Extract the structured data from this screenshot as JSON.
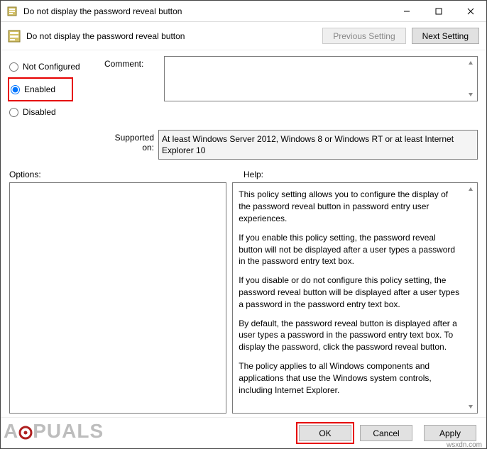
{
  "window": {
    "title": "Do not display the password reveal button",
    "sysmenu": {
      "min": "minimize",
      "max": "maximize",
      "close": "close"
    }
  },
  "toolbar": {
    "title": "Do not display the password reveal button",
    "prev_btn": "Previous Setting",
    "next_btn": "Next Setting"
  },
  "radios": {
    "not_configured": "Not Configured",
    "enabled": "Enabled",
    "disabled": "Disabled",
    "selected": "enabled"
  },
  "labels": {
    "comment": "Comment:",
    "supported": "Supported on:",
    "options": "Options:",
    "help": "Help:"
  },
  "supported_on": "At least Windows Server 2012, Windows 8 or Windows RT or at least Internet Explorer 10",
  "help": {
    "p1": "This policy setting allows you to configure the display of the password reveal button in password entry user experiences.",
    "p2": "If you enable this policy setting, the password reveal button will not be displayed after a user types a password in the password entry text box.",
    "p3": "If you disable or do not configure this policy setting, the password reveal button will be displayed after a user types a password in the password entry text box.",
    "p4": "By default, the password reveal button is displayed after a user types a password in the password entry text box. To display the password, click the password reveal button.",
    "p5": "The policy applies to all Windows components and applications that use the Windows system controls, including Internet Explorer."
  },
  "footer": {
    "ok": "OK",
    "cancel": "Cancel",
    "apply": "Apply"
  },
  "watermark": {
    "brand": "APPUALS",
    "source": "wsxdn.com"
  }
}
